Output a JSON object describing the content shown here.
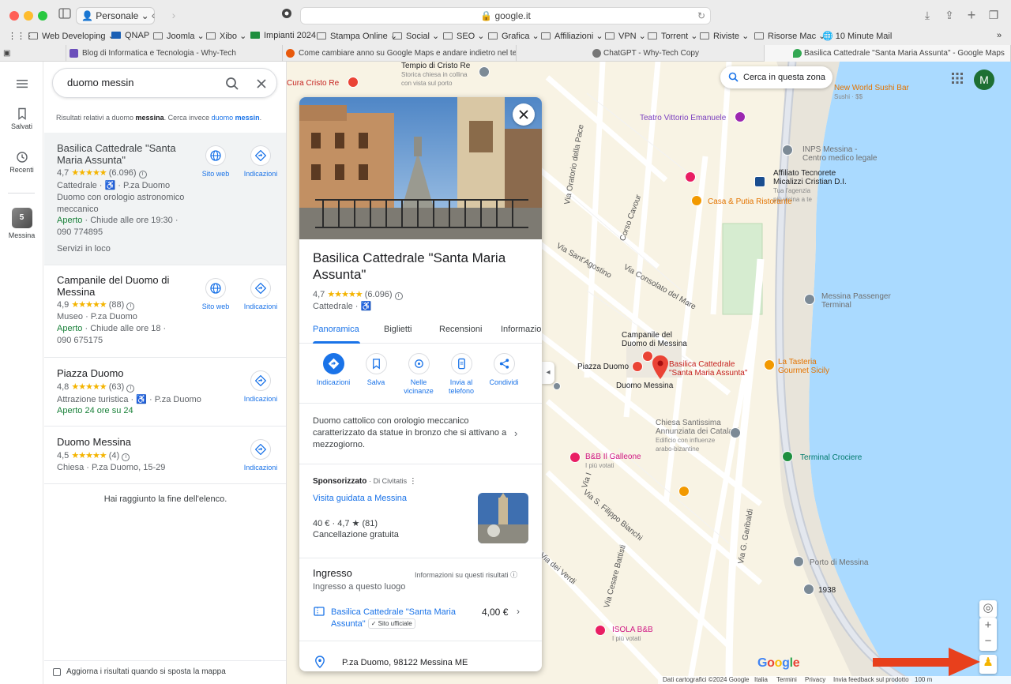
{
  "browser": {
    "profile": "Personale",
    "url": "google.it",
    "bookmarks": [
      "Web Developing",
      "QNAP",
      "Joomla",
      "Xibo",
      "Impianti 2024",
      "Stampa Online",
      "Social",
      "SEO",
      "Grafica",
      "Affiliazioni",
      "VPN",
      "Torrent",
      "Riviste",
      "Risorse Mac",
      "10 Minute Mail"
    ],
    "tabs": [
      {
        "title": "Blog di Informatica e Tecnologia - Why-Tech",
        "icon_color": "#6b4fbb"
      },
      {
        "title": "Come cambiare anno su Google Maps e andare indietro nel temp...",
        "icon_color": "#e8590c"
      },
      {
        "title": "ChatGPT - Why-Tech Copy",
        "icon_color": "#777777"
      },
      {
        "title": "Basilica Cattedrale \"Santa Maria Assunta\" - Google Maps",
        "icon_color": "#34a853"
      }
    ]
  },
  "rail": {
    "menu_icon": "menu-icon",
    "saved": "Salvati",
    "recent": "Recenti",
    "recent_place": "Messina",
    "recent_badge": "5"
  },
  "search": {
    "query": "duomo messin",
    "did_you_mean": {
      "prefix": "Risultati relativi a duomo ",
      "bold1": "messina",
      "middle": ". Cerca invece ",
      "link_a": "duomo ",
      "link_b": "messin",
      "suffix": "."
    }
  },
  "results": [
    {
      "title": "Basilica Cattedrale \"Santa Maria Assunta\"",
      "rating": "4,7",
      "stars": "★★★★★",
      "reviews": "(6.096)",
      "category_line": "Cattedrale · ♿ · P.za Duomo",
      "desc": "Duomo con orologio astronomico meccanico",
      "open": "Aperto",
      "hours": " · Chiude alle ore 19:30 ·",
      "phone": "090 774895",
      "extra": "Servizi in loco",
      "website_label": "Sito web",
      "directions_label": "Indicazioni"
    },
    {
      "title": "Campanile del Duomo di Messina",
      "rating": "4,9",
      "stars": "★★★★★",
      "reviews": "(88)",
      "category_line": "Museo · P.za Duomo",
      "open": "Aperto",
      "hours": " · Chiude alle ore 18 ·",
      "phone": "090 675175",
      "website_label": "Sito web",
      "directions_label": "Indicazioni"
    },
    {
      "title": "Piazza Duomo",
      "rating": "4,8",
      "stars": "★★★★★",
      "reviews": "(63)",
      "category_line": "Attrazione turistica · ♿ · P.za Duomo",
      "open": "Aperto 24 ore su 24",
      "directions_label": "Indicazioni"
    },
    {
      "title": "Duomo Messina",
      "rating": "4,5",
      "stars": "★★★★★",
      "reviews": "(4)",
      "category_line": "Chiesa · P.za Duomo, 15-29",
      "directions_label": "Indicazioni"
    }
  ],
  "end_of_list": "Hai raggiunto la fine dell'elenco.",
  "update_on_move": "Aggiorna i risultati quando si sposta la mappa",
  "place": {
    "title": "Basilica Cattedrale \"Santa Maria Assunta\"",
    "rating": "4,7",
    "stars": "★★★★★",
    "reviews": "(6.096)",
    "category": "Cattedrale · ♿",
    "tabs": [
      "Panoramica",
      "Biglietti",
      "Recensioni",
      "Informazio"
    ],
    "active_tab": "Panoramica",
    "actions": [
      "Indicazioni",
      "Salva",
      "Nelle vicinanze",
      "Invia al telefono",
      "Condividi"
    ],
    "description": "Duomo cattolico con orologio meccanico caratterizzato da statue in bronzo che si attivano a mezzogiorno.",
    "sponsored": {
      "label": "Sponsorizzato",
      "by": "· Di Civitatis",
      "title": "Visita guidata a Messina",
      "price": "40 €",
      "rating": "· 4,7 ★ (81)",
      "cancel": "Cancellazione gratuita"
    },
    "ingresso": {
      "title": "Ingresso",
      "info": "Informazioni su questi risultati",
      "subtitle": "Ingresso a questo luogo",
      "ticket_name": "Basilica Cattedrale \"Santa Maria Assunta\"",
      "official": "Sito ufficiale",
      "ticket_price": "4,00 €"
    },
    "address": "P.za Duomo, 98122 Messina ME"
  },
  "map": {
    "search_this_area": "Cerca in questa zona",
    "avatar_letter": "M",
    "labels": {
      "tempio": "Tempio di Cristo Re",
      "tempio_sub1": "Storica chiesa in collina",
      "tempio_sub2": "con vista sul porto",
      "cura": "Cura Cristo Re",
      "new_world": "New World Sushi Bar",
      "new_world_sub": "Sushi · $$",
      "teatro": "Teatro Vittorio Emanuele",
      "inps": "INPS Messina -",
      "inps_sub": "Centro medico legale",
      "affiliato": "Affiliato Tecnorete",
      "affiliato2": "Micalizzi Cristian D.I.",
      "affiliato_sub1": "Tua l'agenzia",
      "affiliato_sub2": "più vicina a te",
      "casa_putia": "Casa & Putia Ristorante",
      "passenger": "Messina Passenger",
      "passenger2": "Terminal",
      "campanile": "Campanile del",
      "campanile2": "Duomo di Messina",
      "basilica": "Basilica Cattedrale",
      "basilica2": "\"Santa Maria Assunta\"",
      "piazza": "Piazza Duomo",
      "duomo": "Duomo Messina",
      "tasteria": "La Tasteria",
      "tasteria2": "Gourmet Sicily",
      "chiesa": "Chiesa Santissima",
      "chiesa2": "Annunziata dei Catalani",
      "chiesa_sub1": "Edificio con influenze",
      "chiesa_sub2": "arabo-bizantine",
      "bb_galleone": "B&B Il Galleone",
      "bb_galleone_sub": "I più votati",
      "terminal": "Terminal Crociere",
      "porto": "Porto di Messina",
      "year": "1938",
      "isola": "ISOLA B&B",
      "isola_sub": "I più votati",
      "via_oratorio": "Via Oratorio della Pace",
      "corso_cavour": "Corso Cavour",
      "via_sagostino": "Via Sant'Agostino",
      "via_consolato": "Via Consolato del Mare",
      "via_filippo": "Via S. Filippo Bianchi",
      "via_verdi": "Via dei Verdi",
      "via_battisti": "Via Cesare Battisti",
      "via_garibaldi": "Via G. Garibaldi",
      "via_i": "Via I"
    },
    "footer": [
      "Dati cartografici ©2024 Google",
      "Italia",
      "Termini",
      "Privacy",
      "Invia feedback sul prodotto",
      "100 m"
    ],
    "google_logo": "Google"
  }
}
